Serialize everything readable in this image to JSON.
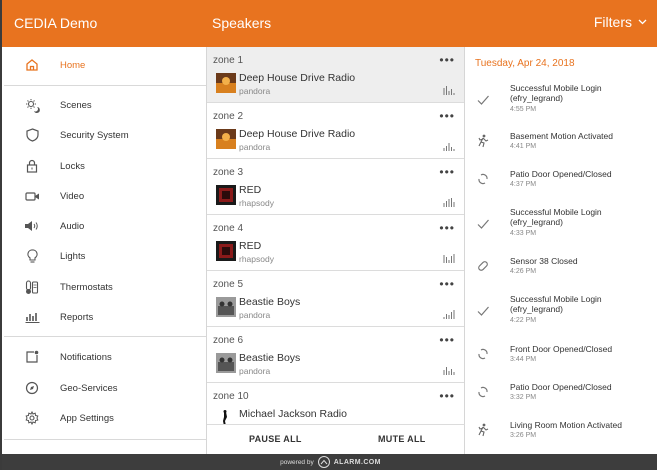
{
  "header": {
    "app_title": "CEDIA Demo",
    "section_title": "Speakers",
    "filters_label": "Filters"
  },
  "sidebar": {
    "items": [
      {
        "label": "Home",
        "icon": "home-icon",
        "active": true
      },
      {
        "label": "Scenes",
        "icon": "scenes-icon"
      },
      {
        "label": "Security System",
        "icon": "shield-icon"
      },
      {
        "label": "Locks",
        "icon": "lock-icon"
      },
      {
        "label": "Video",
        "icon": "video-camera-icon"
      },
      {
        "label": "Audio",
        "icon": "speaker-icon"
      },
      {
        "label": "Lights",
        "icon": "lightbulb-icon"
      },
      {
        "label": "Thermostats",
        "icon": "thermostat-icon"
      },
      {
        "label": "Reports",
        "icon": "bar-chart-icon"
      },
      {
        "label": "Notifications",
        "icon": "notification-icon"
      },
      {
        "label": "Geo-Services",
        "icon": "compass-icon"
      },
      {
        "label": "App Settings",
        "icon": "gear-icon"
      }
    ]
  },
  "zones": [
    {
      "name": "zone 1",
      "title": "Deep House Drive Radio",
      "source": "pandora",
      "art": "orange",
      "selected": true
    },
    {
      "name": "zone 2",
      "title": "Deep House Drive Radio",
      "source": "pandora",
      "art": "orange"
    },
    {
      "name": "zone 3",
      "title": "RED",
      "source": "rhapsody",
      "art": "red"
    },
    {
      "name": "zone 4",
      "title": "RED",
      "source": "rhapsody",
      "art": "red"
    },
    {
      "name": "zone 5",
      "title": "Beastie Boys",
      "source": "pandora",
      "art": "gray"
    },
    {
      "name": "zone 6",
      "title": "Beastie Boys",
      "source": "pandora",
      "art": "gray"
    },
    {
      "name": "zone 10",
      "title": "Michael Jackson Radio",
      "source": "",
      "art": "mj"
    }
  ],
  "zone_controls": {
    "pause_all": "PAUSE ALL",
    "mute_all": "MUTE ALL"
  },
  "events": {
    "date": "Tuesday, Apr 24, 2018",
    "items": [
      {
        "text": "Successful Mobile Login (efry_legrand)",
        "time": "4:55 PM",
        "icon": "checkmark-icon"
      },
      {
        "text": "Basement Motion Activated",
        "time": "4:41 PM",
        "icon": "motion-icon"
      },
      {
        "text": "Patio Door Opened/Closed",
        "time": "4:37 PM",
        "icon": "door-sensor-icon"
      },
      {
        "text": "Successful Mobile Login (efry_legrand)",
        "time": "4:33 PM",
        "icon": "checkmark-icon"
      },
      {
        "text": "Sensor 38 Closed",
        "time": "4:26 PM",
        "icon": "sensor-closed-icon"
      },
      {
        "text": "Successful Mobile Login (efry_legrand)",
        "time": "4:22 PM",
        "icon": "checkmark-icon"
      },
      {
        "text": "Front Door Opened/Closed",
        "time": "3:44 PM",
        "icon": "door-sensor-icon"
      },
      {
        "text": "Patio Door Opened/Closed",
        "time": "3:32 PM",
        "icon": "door-sensor-icon"
      },
      {
        "text": "Living Room Motion Activated",
        "time": "3:26 PM",
        "icon": "motion-icon"
      }
    ]
  },
  "footer": {
    "powered_by": "powered by",
    "brand": "ALARM.COM"
  },
  "colors": {
    "accent": "#e8731f",
    "footer_bg": "#3d3d3d"
  }
}
